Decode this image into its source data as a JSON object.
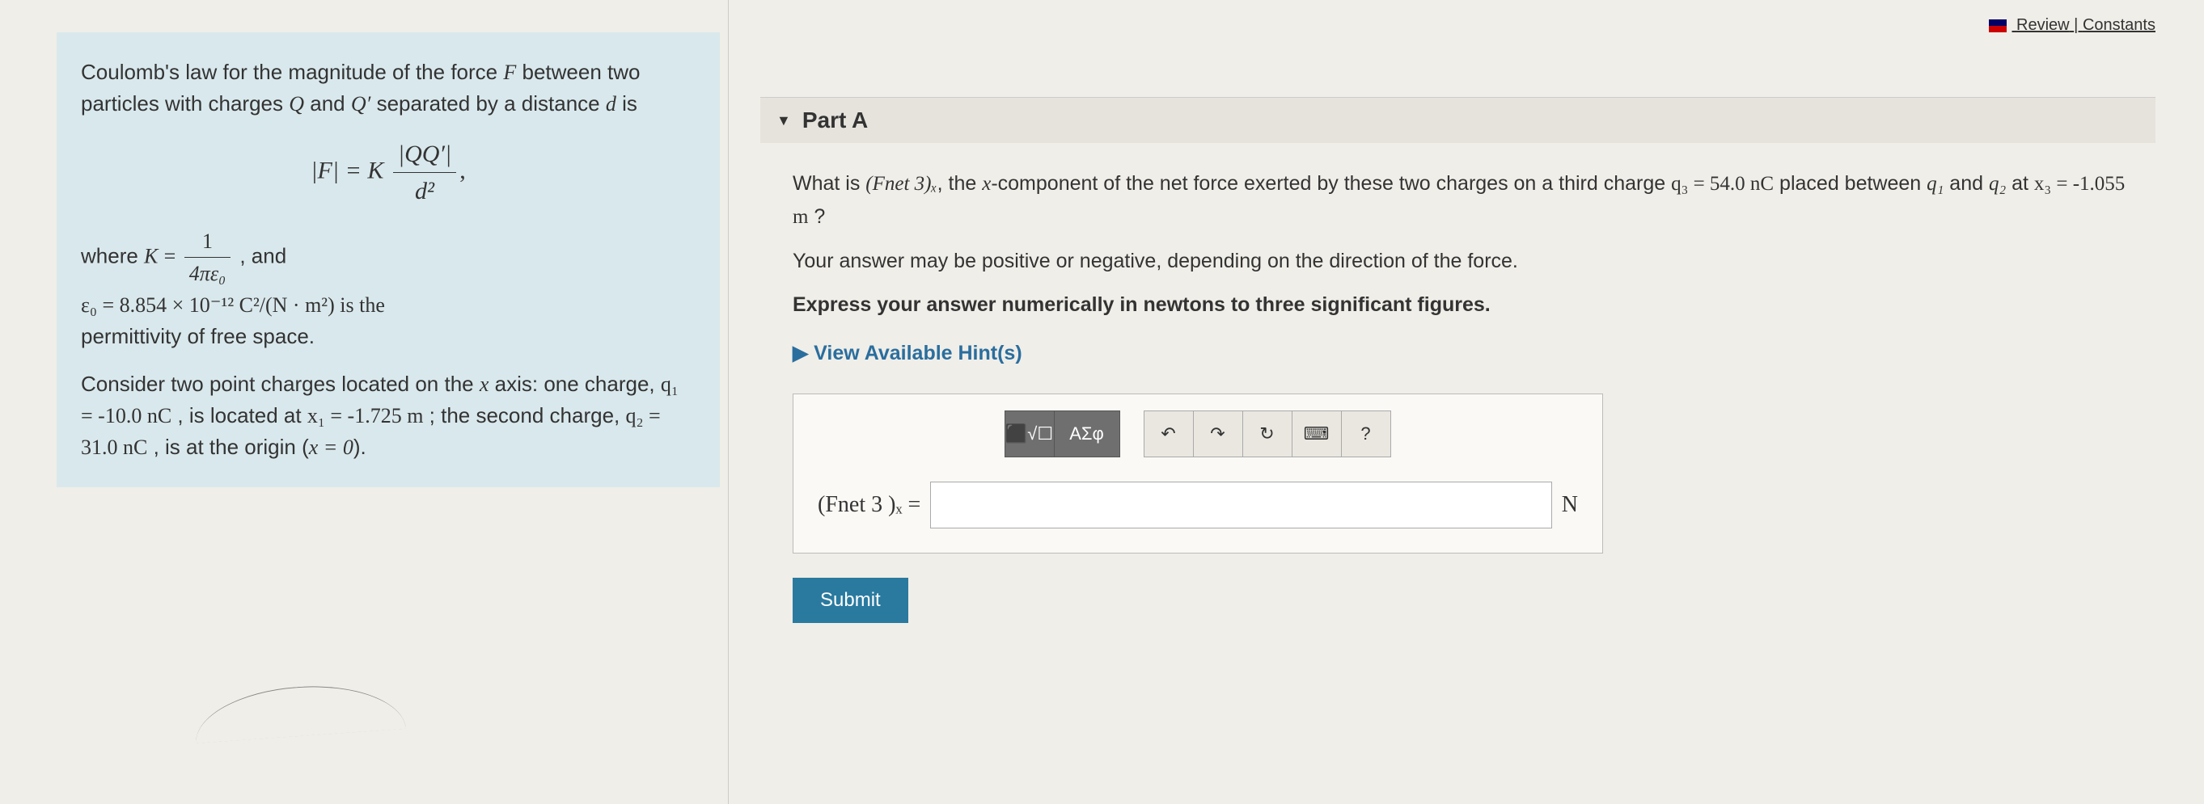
{
  "topLinks": {
    "review": "Review",
    "constants": "Constants"
  },
  "left": {
    "intro1": "Coulomb's law for the magnitude of the force ",
    "intro2": " between two particles with charges ",
    "intro3": " and ",
    "intro4": " separated by a distance ",
    "intro5": " is",
    "F": "F",
    "Q": "Q",
    "Qp": "Q′",
    "d": "d",
    "formulaLHS": "|F| = K",
    "formulaNum": "|QQ′|",
    "formulaDen": "d²",
    "comma": ",",
    "whereK": "where ",
    "K": "K",
    "eq": " = ",
    "kfracNum": "1",
    "kfracDen": "4πε₀",
    "and": " , and",
    "eps0line": "ε₀ = 8.854 × 10⁻¹² C²/(N · m²) is the",
    "permLine": "permittivity of free space.",
    "para2a": "Consider two point charges located on the ",
    "xaxis": "x",
    "para2b": " axis: one charge, ",
    "q1eq": "q₁ = -10.0 nC",
    "para2c": " , is located at ",
    "x1eq": "x₁ = -1.725 m",
    "para2d": " ; the second charge, ",
    "q2eq": "q₂ = 31.0 nC",
    "para2e": " , is at the origin (",
    "xeq0": "x = 0",
    "para2f": ")."
  },
  "part": {
    "title": "Part A",
    "q1": "What is ",
    "fnet": "(Fnet 3)ₓ",
    "q2": ", the ",
    "xcomp": "x",
    "q3": "-component of the net force exerted by these two charges on a third charge ",
    "q3val": "q₃ = 54.0 nC",
    "q4": " placed between ",
    "q1sym": "q₁",
    "q5": " and ",
    "q2sym": "q₂",
    "q6": " at ",
    "x3val": "x₃ = -1.055 m",
    "q7": " ?",
    "note": "Your answer may be positive or negative, depending on the direction of the force.",
    "instr": "Express your answer numerically in newtons to three significant figures.",
    "hints": "View Available Hint(s)",
    "answerLabel": "(Fnet 3 )ₓ =",
    "unit": "N",
    "toolbar": {
      "template": "⬛√☐",
      "greek": "ΑΣφ",
      "undo": "↶",
      "redo": "↷",
      "reset": "↻",
      "keyboard": "⌨",
      "help": "?"
    },
    "submit": "Submit"
  }
}
